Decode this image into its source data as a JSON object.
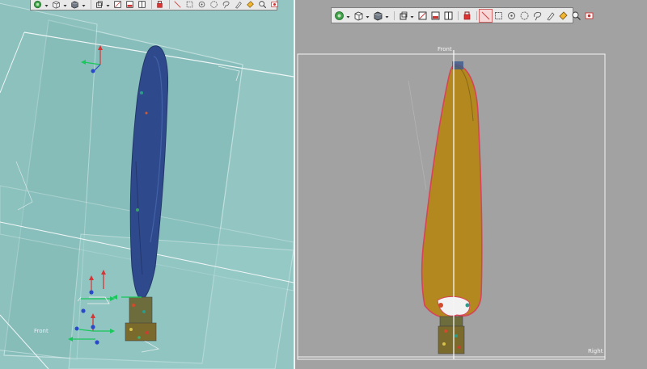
{
  "left_viewport": {
    "view_label": "Front",
    "background": "#93c6c3",
    "toolbar_icons": [
      "sphere-icon",
      "cube-icon",
      "box-shaded-icon",
      "box-wire-icon",
      "front-view-icon",
      "section-view-icon",
      "split-view-icon",
      "measure-icon",
      "line-tool-icon",
      "rect-select-icon",
      "point-select-icon",
      "circle-select-icon",
      "lasso-select-icon",
      "brush-select-icon",
      "fill-select-icon",
      "zoom-icon",
      "extents-icon"
    ]
  },
  "right_viewport": {
    "top_label": "Front",
    "corner_label": "Right",
    "background": "#a2a2a2",
    "toolbar_icons": [
      "sphere-icon",
      "cube-icon",
      "box-shaded-icon",
      "box-wire-icon",
      "front-view-icon",
      "section-view-icon",
      "split-view-icon",
      "measure-icon",
      "line-tool-icon",
      "rect-select-icon",
      "point-select-icon",
      "circle-select-icon",
      "lasso-select-icon",
      "brush-select-icon",
      "fill-select-icon",
      "zoom-icon",
      "extents-icon"
    ],
    "active_tool": "line-tool-icon"
  },
  "colors": {
    "blade_left": "#2f4a8c",
    "blade_right_fill": "#b3881e",
    "blade_outline": "#d9435a",
    "axis_x": "#18c85a",
    "axis_y": "#d63535",
    "axis_z": "#2a49c9"
  }
}
